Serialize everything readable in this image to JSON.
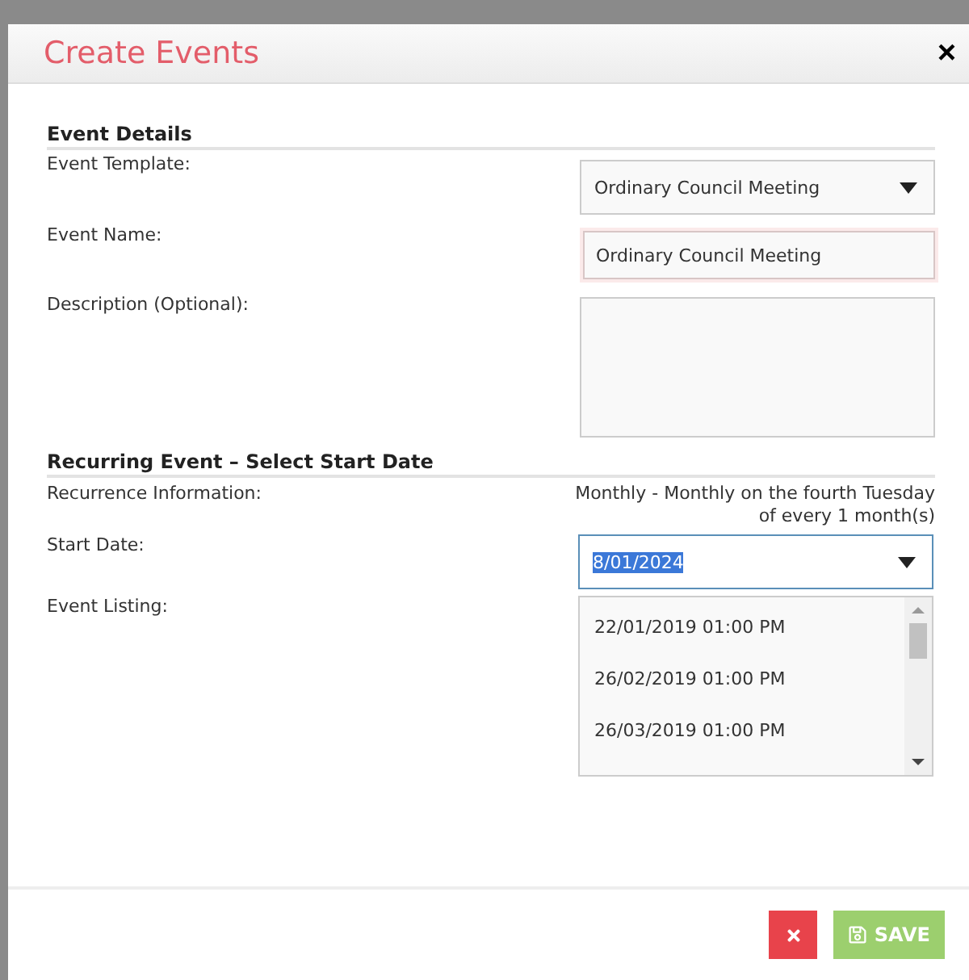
{
  "dialog": {
    "title": "Create Events",
    "close": "×"
  },
  "sections": [
    {
      "heading": "Event Details",
      "fields": [
        {
          "kind": "select",
          "label": "Event Template:",
          "value": "Ordinary Council Meeting"
        },
        {
          "kind": "input",
          "label": "Event Name:",
          "value": "Ordinary Council Meeting"
        },
        {
          "kind": "textarea",
          "label": "Description (Optional):"
        }
      ]
    },
    {
      "heading": "Recurring Event – Select Start Date",
      "fields": [
        {
          "kind": "info",
          "label": "Recurrence Information:",
          "lines": [
            "Monthly - Monthly on the fourth Tuesday",
            "of every 1 month(s)"
          ]
        },
        {
          "kind": "date",
          "label": "Start Date:",
          "value": "8/01/2024"
        },
        {
          "kind": "listing",
          "label": "Event Listing:",
          "items": [
            "22/01/2019 01:00 PM",
            "26/02/2019 01:00 PM",
            "26/03/2019 01:00 PM"
          ]
        }
      ]
    }
  ],
  "footer": {
    "save": "SAVE"
  }
}
